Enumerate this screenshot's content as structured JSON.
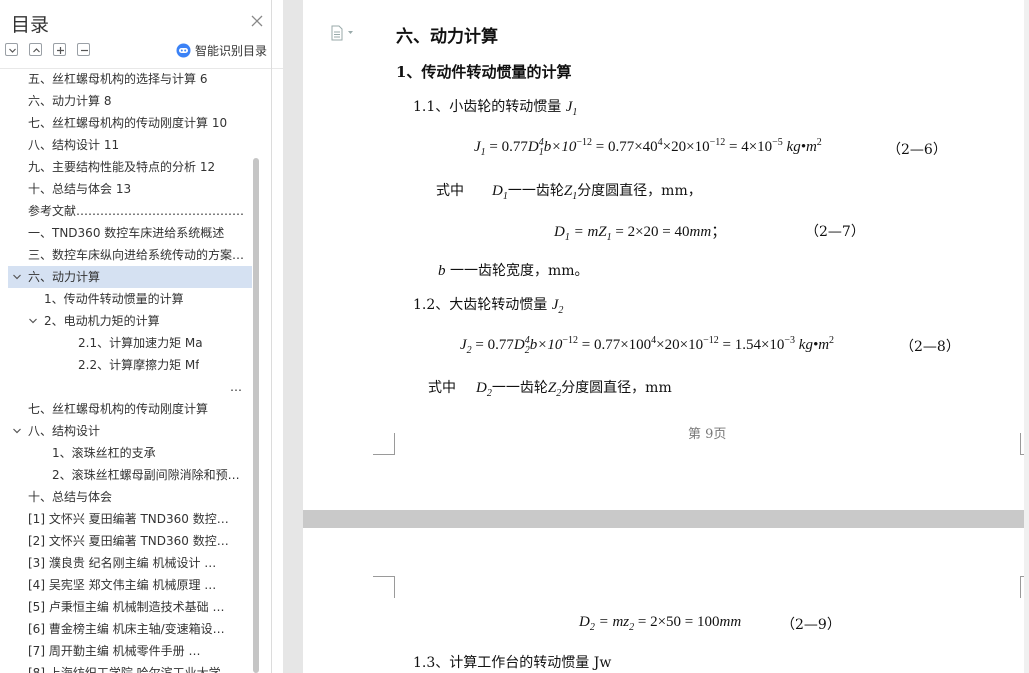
{
  "toc": {
    "title": "目录",
    "smart_label": "智能识别目录",
    "items": [
      {
        "text": "五、丝杠螺母机构的选择与计算 6",
        "level": 0,
        "toggle": "",
        "selected": false
      },
      {
        "text": "六、动力计算 8",
        "level": 0,
        "toggle": "",
        "selected": false
      },
      {
        "text": "七、丝杠螺母机构的传动刚度计算 10",
        "level": 0,
        "toggle": "",
        "selected": false
      },
      {
        "text": "八、结构设计 11",
        "level": 0,
        "toggle": "",
        "selected": false
      },
      {
        "text": "九、主要结构性能及特点的分析 12",
        "level": 0,
        "toggle": "",
        "selected": false
      },
      {
        "text": "十、总结与体会 13",
        "level": 0,
        "toggle": "",
        "selected": false
      },
      {
        "text": "参考文献……………………………………………",
        "level": 0,
        "toggle": "",
        "selected": false
      },
      {
        "text": "一、TND360 数控车床进给系统概述",
        "level": 0,
        "toggle": "",
        "selected": false
      },
      {
        "text": "三、数控车床纵向进给系统传动的方案…",
        "level": 0,
        "toggle": "",
        "selected": false
      },
      {
        "text": "六、动力计算",
        "level": 0,
        "toggle": "open",
        "selected": true
      },
      {
        "text": "1、传动件转动惯量的计算",
        "level": 1,
        "toggle": "",
        "selected": false
      },
      {
        "text": "2、电动机力矩的计算",
        "level": 1,
        "toggle": "open",
        "selected": false
      },
      {
        "text": "2.1、计算加速力矩 Ma",
        "level": 3,
        "toggle": "",
        "selected": false
      },
      {
        "text": "2.2、计算摩擦力矩 Mf",
        "level": 3,
        "toggle": "",
        "selected": false
      },
      {
        "text": "…",
        "level": 5,
        "toggle": "",
        "selected": false
      },
      {
        "text": "七、丝杠螺母机构的传动刚度计算",
        "level": 0,
        "toggle": "",
        "selected": false
      },
      {
        "text": "八、结构设计",
        "level": 0,
        "toggle": "open",
        "selected": false
      },
      {
        "text": "1、滚珠丝杠的支承",
        "level": 2,
        "toggle": "",
        "selected": false
      },
      {
        "text": "2、滚珠丝杠螺母副间隙消除和预…",
        "level": 2,
        "toggle": "",
        "selected": false
      },
      {
        "text": "十、总结与体会",
        "level": 0,
        "toggle": "",
        "selected": false
      },
      {
        "text": "[1] 文怀兴  夏田编著     TND360 数控…",
        "level": 0,
        "toggle": "",
        "selected": false
      },
      {
        "text": "[2] 文怀兴  夏田编著     TND360 数控…",
        "level": 0,
        "toggle": "",
        "selected": false
      },
      {
        "text": "[3] 濮良贵  纪名刚主编     机械设计    …",
        "level": 0,
        "toggle": "",
        "selected": false
      },
      {
        "text": "[4] 吴宪坚  郑文伟主编     机械原理    …",
        "level": 0,
        "toggle": "",
        "selected": false
      },
      {
        "text": "[5] 卢秉恒主编     机械制造技术基础  …",
        "level": 0,
        "toggle": "",
        "selected": false
      },
      {
        "text": "[6] 曹金榜主编     机床主轴/变速箱设…",
        "level": 0,
        "toggle": "",
        "selected": false
      },
      {
        "text": "[7] 周开勤主编     机械零件手册       …",
        "level": 0,
        "toggle": "",
        "selected": false
      },
      {
        "text": "[8] 上海纺织工学院   哈尔滨工业大学  …",
        "level": 0,
        "toggle": "",
        "selected": false
      }
    ]
  },
  "doc": {
    "h1": "六、动力计算",
    "h2": "1、传动件转动惯量的计算",
    "s11": "1.1、小齿轮的转动惯量",
    "s11_sym": "J",
    "s11_sub": "1",
    "eq1_lhs": "J",
    "eq1_lhs_sub": "1",
    "eq1_body_a": " = 0.77",
    "eq1_d": "D",
    "eq1_d_sub": "1",
    "eq1_body_b": "b×10",
    "eq1_exp1": "−12",
    "eq1_body_c": " = 0.77×40",
    "eq1_exp2": "4",
    "eq1_body_d": "×20×10",
    "eq1_exp3": "−12",
    "eq1_body_e": " = 4×10",
    "eq1_exp4": "−5",
    "eq1_unit": " kg•m",
    "eq1_unit_exp": "2",
    "eq1_num": "（2—6）",
    "where1_a": "式中",
    "where1_sym": "D",
    "where1_sub": "1",
    "where1_text": "一一齿轮",
    "where1_z": "Z",
    "where1_zsub": "1",
    "where1_tail": "分度圆直径，mm，",
    "eq2_a": "D",
    "eq2_a_sub": "1",
    "eq2_b": " = mZ",
    "eq2_b_sub": "1",
    "eq2_c": " = 2×20 = 40",
    "eq2_unit": "mm",
    "eq2_semi": "；",
    "eq2_num": "（2—7）",
    "b_line_sym": "b",
    "b_line_text": "一一齿轮宽度，mm。",
    "s12": "1.2、大齿轮转动惯量",
    "s12_sym": "J",
    "s12_sub": "2",
    "eq3_lhs": "J",
    "eq3_lhs_sub": "2",
    "eq3_body_a": " = 0.77",
    "eq3_d": "D",
    "eq3_d_sub": "2",
    "eq3_body_b": "b×10",
    "eq3_exp1": "−12",
    "eq3_body_c": " = 0.77×100",
    "eq3_exp2": "4",
    "eq3_body_d": "×20×10",
    "eq3_exp3": "−12",
    "eq3_body_e": " = 1.54×10",
    "eq3_exp4": "−3",
    "eq3_unit": " kg•m",
    "eq3_unit_exp": "2",
    "eq3_num": "（2—8）",
    "where2_a": "式中",
    "where2_sym": "D",
    "where2_sub": "2",
    "where2_text": "一一齿轮",
    "where2_z": "Z",
    "where2_zsub": "2",
    "where2_tail": "分度圆直径，mm",
    "page_label": "第 9页",
    "eq4_a": "D",
    "eq4_a_sub": "2",
    "eq4_b": " = mz",
    "eq4_b_sub": "2",
    "eq4_c": " = 2×50 = 100",
    "eq4_unit": "mm",
    "eq4_num": "（2—9）",
    "s13": "1.3、计算工作台的转动惯量 Jw"
  }
}
